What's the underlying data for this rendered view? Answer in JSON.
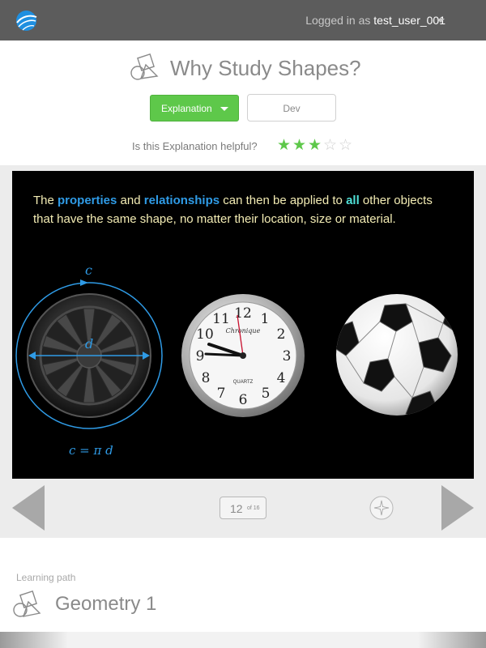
{
  "topbar": {
    "logged_prefix": "Logged in as ",
    "username": "test_user_001",
    "logo_icon": "globe-logo-icon",
    "menu_icon": "caret-down-icon"
  },
  "header": {
    "title": "Why Study Shapes?",
    "title_icon": "shapes-icon",
    "explanation_button": "Explanation",
    "dev_button": "Dev",
    "helpful_prompt": "Is this Explanation helpful?",
    "rating": {
      "value": 3,
      "max": 5
    }
  },
  "panel": {
    "text": {
      "p1": "The ",
      "hl1": "properties",
      "p2": " and ",
      "hl2": "relationships",
      "p3": " can then be applied to ",
      "hl3": "all",
      "p4": " other objects that have the same shape, no matter their location, size or material."
    },
    "wheel": {
      "label_c": "c",
      "label_d": "d",
      "formula": "c = π d"
    },
    "clock": {
      "brand": "Chronique",
      "sub": "QUARTZ",
      "numbers": [
        "12",
        "1",
        "2",
        "3",
        "4",
        "5",
        "6",
        "7",
        "8",
        "9",
        "10",
        "11"
      ]
    }
  },
  "nav": {
    "page": "12",
    "of_label": "of 16",
    "prev_icon": "prev-arrow-icon",
    "next_icon": "next-arrow-icon",
    "compass_icon": "compass-icon"
  },
  "learning_path": {
    "label": "Learning path",
    "title": "Geometry 1"
  },
  "colors": {
    "topbar": "#5c5c5c",
    "accent_green": "#5ec84a",
    "highlight_blue": "#2f9be6",
    "highlight_teal": "#4fe0d6",
    "panel_text": "#f3ecb4"
  }
}
